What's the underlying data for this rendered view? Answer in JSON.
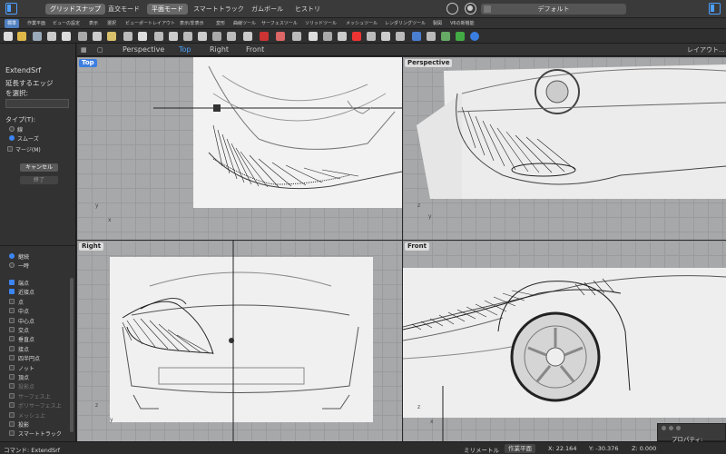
{
  "modebar": {
    "modes": [
      {
        "label": "グリッドスナップ",
        "on": true
      },
      {
        "label": "直交モード",
        "on": false
      },
      {
        "label": "平面モード",
        "on": true
      },
      {
        "label": "スマートトラック",
        "on": false
      },
      {
        "label": "ガムボール",
        "on": false
      },
      {
        "label": "ヒストリ",
        "on": false
      }
    ],
    "cplane": "デフォルト"
  },
  "tabs": [
    "標準",
    "作業平面",
    "ビューの設定",
    "表示",
    "選択",
    "ビューポートレイアウト",
    "表示/非表示",
    "変形",
    "曲線ツール",
    "サーフェスツール",
    "ソリッドツール",
    "メッシュツール",
    "レンダリングツール",
    "製図",
    "V6の新機能"
  ],
  "viewport_tabs": [
    "Perspective",
    "Top",
    "Right",
    "Front"
  ],
  "viewport_tabs_right": "レイアウト...",
  "command_panel": {
    "title": "ExtendSrf",
    "prompt_line1": "延長するエッジ",
    "prompt_line2": "を選択:",
    "type_label": "タイプ(T):",
    "type_option1": "線",
    "type_option2": "スムーズ",
    "merge_label": "マージ(M)",
    "cancel": "キャンセル",
    "finish": "終了"
  },
  "osnap": {
    "mode1": "継続",
    "mode2": "一時",
    "items": [
      {
        "label": "端点",
        "on": true,
        "dim": false
      },
      {
        "label": "近接点",
        "on": true,
        "dim": false
      },
      {
        "label": "点",
        "on": false,
        "dim": false
      },
      {
        "label": "中点",
        "on": false,
        "dim": false
      },
      {
        "label": "中心点",
        "on": false,
        "dim": false
      },
      {
        "label": "交点",
        "on": false,
        "dim": false
      },
      {
        "label": "垂直点",
        "on": false,
        "dim": false
      },
      {
        "label": "接点",
        "on": false,
        "dim": false
      },
      {
        "label": "四半円点",
        "on": false,
        "dim": false
      },
      {
        "label": "ノット",
        "on": false,
        "dim": false
      },
      {
        "label": "頂点",
        "on": false,
        "dim": false
      },
      {
        "label": "投影点",
        "on": false,
        "dim": true
      },
      {
        "label": "サーフェス上",
        "on": false,
        "dim": true
      },
      {
        "label": "ポリサーフェス上",
        "on": false,
        "dim": true
      },
      {
        "label": "メッシュ上",
        "on": false,
        "dim": true
      },
      {
        "label": "投影",
        "on": false,
        "dim": false
      },
      {
        "label": "スマートトラック",
        "on": false,
        "dim": false
      }
    ]
  },
  "viewports": {
    "top": "Top",
    "perspective": "Perspective",
    "right": "Right",
    "front": "Front"
  },
  "axes": {
    "x": "x",
    "y": "y",
    "z": "z"
  },
  "status": {
    "command": "コマンド: ExtendSrf",
    "units": "ミリメートル",
    "cplane": "作業平面",
    "x": "X: 22.164",
    "y": "Y: -30.376",
    "z": "Z: 0.000",
    "properties": "プロパティ: "
  },
  "colors": {
    "accent": "#3c7ee0",
    "viewport_bg": "#a7a8aa",
    "panel_bg": "#323232"
  }
}
